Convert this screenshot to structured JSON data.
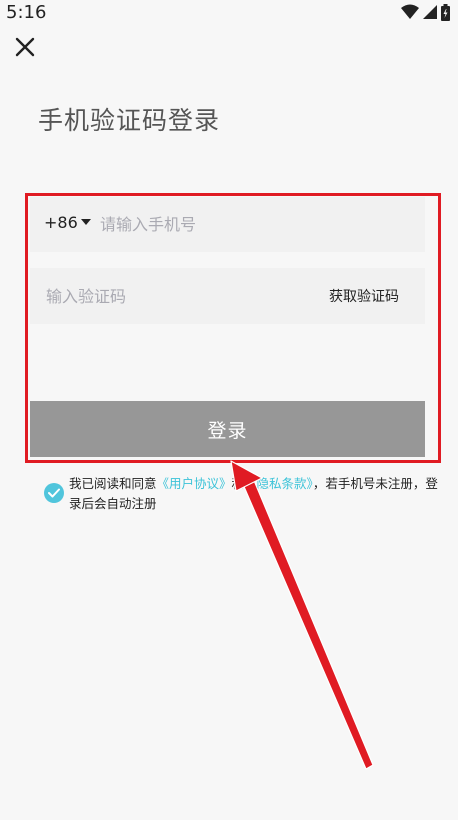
{
  "status_bar": {
    "time": "5:16"
  },
  "header": {
    "close_icon": "close-icon",
    "title": "手机验证码登录"
  },
  "form": {
    "country_code": "+86",
    "phone_placeholder": "请输入手机号",
    "code_placeholder": "输入验证码",
    "get_code_label": "获取验证码",
    "login_label": "登录"
  },
  "agreement": {
    "checked": true,
    "text_before": "我已阅读和同意",
    "user_agreement": "《用户协议》",
    "and": "和",
    "privacy_policy": "《隐私条款》",
    "text_after": "，若手机号未注册，登录后会自动注册"
  },
  "colors": {
    "accent": "#3cc3d8",
    "button": "#979797",
    "highlight": "#e01b23",
    "background": "#f7f7f7"
  }
}
